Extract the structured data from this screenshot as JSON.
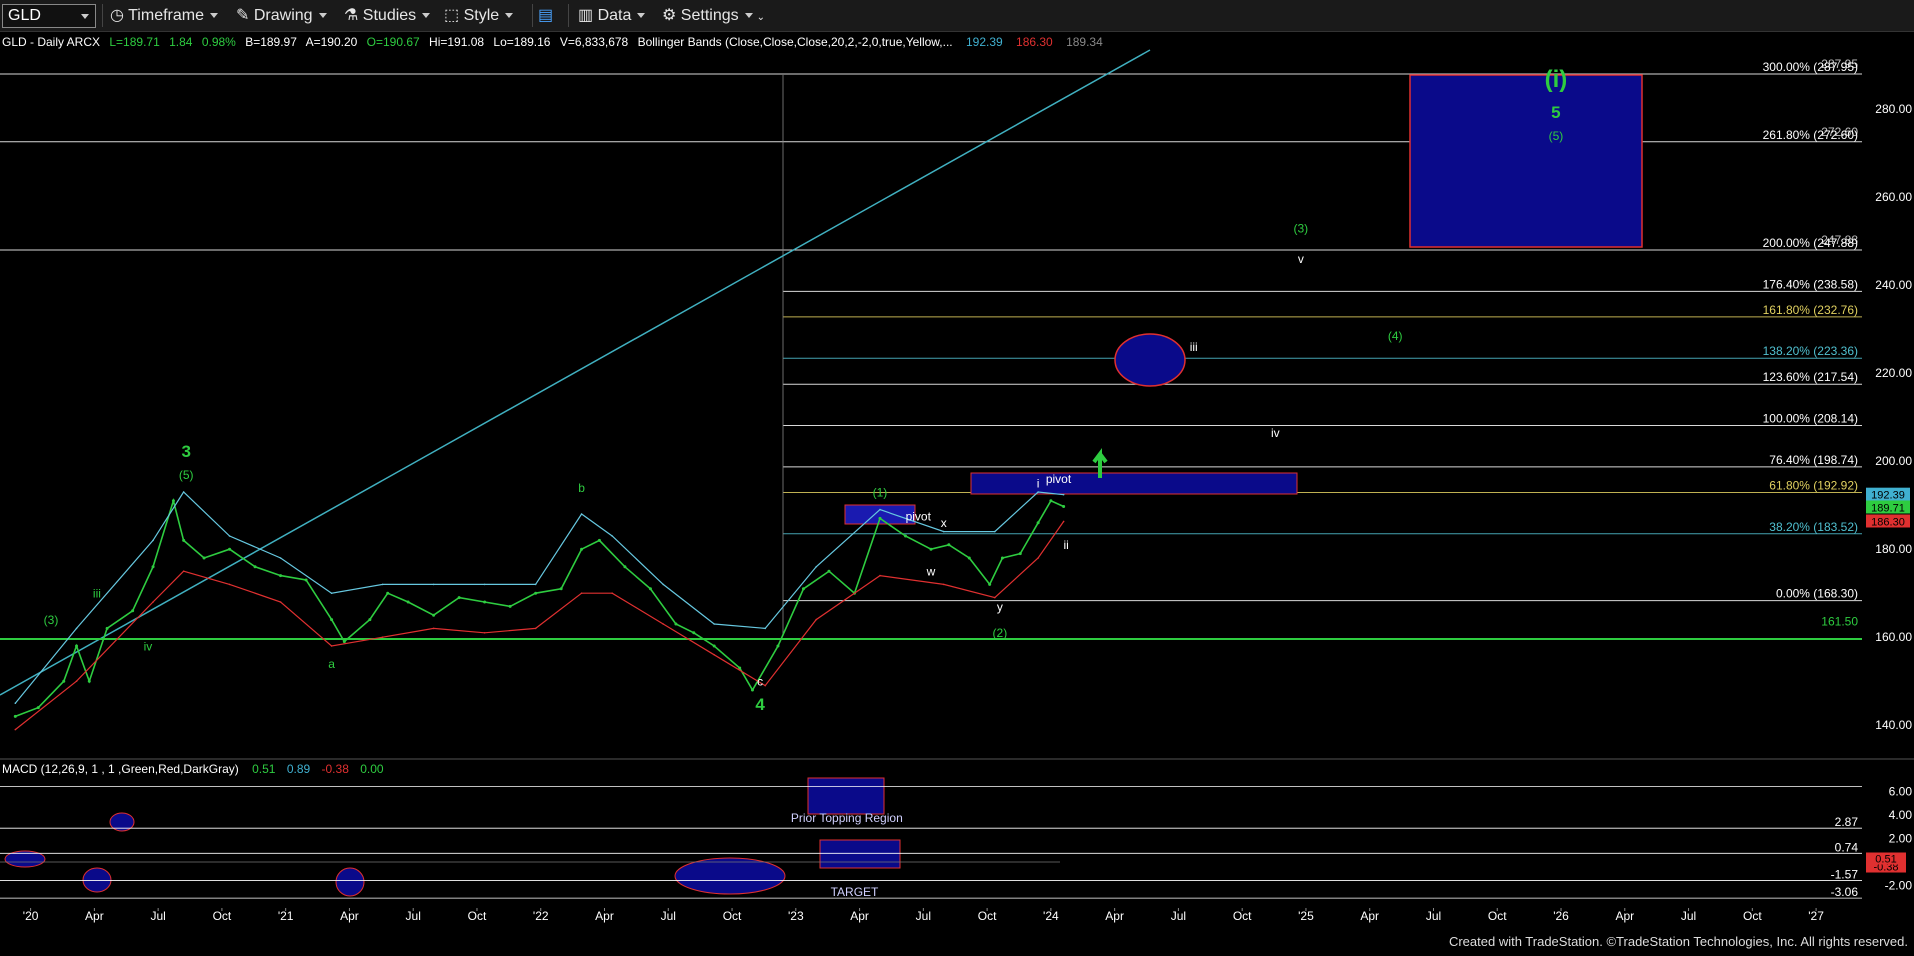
{
  "toolbar": {
    "symbol": "GLD",
    "timeframe_label": "Timeframe",
    "drawing_label": "Drawing",
    "studies_label": "Studies",
    "style_label": "Style",
    "data_label": "Data",
    "settings_label": "Settings"
  },
  "header": {
    "instrument": "GLD - Daily  ARCX",
    "last": "L=189.71",
    "change": "1.84",
    "change_pct": "0.98%",
    "bid": "B=189.97",
    "ask": "A=190.20",
    "open": "O=190.67",
    "high": "Hi=191.08",
    "low": "Lo=189.16",
    "volume": "V=6,833,678",
    "study": "Bollinger Bands (Close,Close,Close,20,2,-2,0,true,Yellow,...",
    "bb_upper": "192.39",
    "bb_lower": "186.30",
    "bb_mid": "189.34"
  },
  "macd_header": {
    "study": "MACD (12,26,9, 1 , 1 ,Green,Red,DarkGray)",
    "macd": "0.51",
    "signal": "0.89",
    "hist": "-0.38",
    "zero": "0.00"
  },
  "footer": {
    "text": "Created with TradeStation. ©TradeStation Technologies, Inc. All rights reserved."
  },
  "chart_data": {
    "type": "line",
    "title": "GLD - Daily",
    "x_ticks": [
      "'20",
      "Apr",
      "Jul",
      "Oct",
      "'21",
      "Apr",
      "Jul",
      "Oct",
      "'22",
      "Apr",
      "Jul",
      "Oct",
      "'23",
      "Apr",
      "Jul",
      "Oct",
      "'24",
      "Apr",
      "Jul",
      "Oct",
      "'25",
      "Apr",
      "Jul",
      "Oct",
      "'26",
      "Apr",
      "Jul",
      "Oct",
      "'27"
    ],
    "y_ticks": [
      "280.00",
      "260.00",
      "240.00",
      "220.00",
      "200.00",
      "180.00",
      "160.00",
      "140.00"
    ],
    "ylim": [
      133,
      293
    ],
    "macd_ticks": [
      "6.00",
      "4.00",
      "2.00",
      "-2.00"
    ],
    "macd_ylim": [
      -3.9,
      7.3
    ],
    "series": [
      {
        "name": "GLD",
        "color": "#2ecc40",
        "x": [
          2019.96,
          2020.05,
          2020.15,
          2020.2,
          2020.25,
          2020.32,
          2020.42,
          2020.5,
          2020.58,
          2020.62,
          2020.7,
          2020.8,
          2020.9,
          2021.0,
          2021.1,
          2021.2,
          2021.25,
          2021.35,
          2021.42,
          2021.5,
          2021.6,
          2021.7,
          2021.8,
          2021.9,
          2022.0,
          2022.1,
          2022.18,
          2022.25,
          2022.35,
          2022.45,
          2022.55,
          2022.62,
          2022.7,
          2022.8,
          2022.85,
          2022.95,
          2023.05,
          2023.15,
          2023.25,
          2023.35,
          2023.45,
          2023.55,
          2023.62,
          2023.7,
          2023.78,
          2023.83,
          2023.9,
          2023.97,
          2024.02,
          2024.07
        ],
        "y": [
          142,
          144,
          150,
          158,
          150,
          162,
          166,
          176,
          191,
          182,
          178,
          180,
          176,
          174,
          173,
          164,
          159,
          164,
          170,
          168,
          165,
          169,
          168,
          167,
          170,
          171,
          180,
          182,
          176,
          171,
          163,
          161,
          158,
          153,
          148,
          158,
          171,
          175,
          170,
          187,
          183,
          180,
          181,
          178,
          172,
          178,
          179,
          186,
          191,
          189.71
        ]
      },
      {
        "name": "upper-band",
        "color": "#66c8e0",
        "x": [
          2019.96,
          2020.2,
          2020.5,
          2020.62,
          2020.8,
          2021.0,
          2021.2,
          2021.4,
          2021.6,
          2021.8,
          2022.0,
          2022.18,
          2022.3,
          2022.5,
          2022.7,
          2022.9,
          2023.1,
          2023.35,
          2023.6,
          2023.8,
          2023.97,
          2024.07
        ],
        "y": [
          145,
          162,
          182,
          193,
          183,
          178,
          170,
          172,
          172,
          172,
          172,
          188,
          183,
          172,
          163,
          162,
          176,
          189,
          184,
          184,
          193,
          192.39
        ]
      },
      {
        "name": "lower-band",
        "color": "#e03030",
        "x": [
          2019.96,
          2020.2,
          2020.5,
          2020.62,
          2020.8,
          2021.0,
          2021.2,
          2021.4,
          2021.6,
          2021.8,
          2022.0,
          2022.18,
          2022.3,
          2022.5,
          2022.7,
          2022.9,
          2023.1,
          2023.35,
          2023.6,
          2023.8,
          2023.97,
          2024.07
        ],
        "y": [
          139,
          150,
          168,
          175,
          172,
          168,
          158,
          160,
          162,
          161,
          162,
          170,
          170,
          163,
          156,
          149,
          164,
          174,
          172,
          169,
          178,
          186.3
        ]
      }
    ],
    "fib_levels": [
      {
        "label": "300.00%",
        "value": "287.95",
        "y": 288,
        "color": "#ffffff"
      },
      {
        "label": "261.80%",
        "value": "272.60",
        "y": 272.6,
        "color": "#ffffff"
      },
      {
        "label": "200.00%",
        "value": "247.88",
        "y": 248,
        "color": "#ffffff"
      },
      {
        "label": "176.40%",
        "value": "238.58",
        "y": 238.6,
        "color": "#ffffff"
      },
      {
        "label": "161.80%",
        "value": "232.76",
        "y": 232.8,
        "color": "#e0d060"
      },
      {
        "label": "138.20%",
        "value": "223.36",
        "y": 223.4,
        "color": "#50c0d0"
      },
      {
        "label": "123.60%",
        "value": "217.54",
        "y": 217.5,
        "color": "#ffffff"
      },
      {
        "label": "100.00%",
        "value": "208.14",
        "y": 208.1,
        "color": "#ffffff"
      },
      {
        "label": "76.40%",
        "value": "198.74",
        "y": 198.7,
        "color": "#ffffff"
      },
      {
        "label": "61.80%",
        "value": "192.92",
        "y": 192.9,
        "color": "#e0d060"
      },
      {
        "label": "38.20%",
        "value": "183.52",
        "y": 183.5,
        "color": "#50c0d0"
      },
      {
        "label": "0.00%",
        "value": "168.30",
        "y": 168.3,
        "color": "#ffffff"
      }
    ],
    "extra_values": [
      "287.95",
      "272.60",
      "247.88"
    ],
    "support_line": {
      "label": "161.50",
      "y": 161.5
    },
    "price_tags": [
      {
        "text": "192.39",
        "y": 192.39,
        "bg": "#40b0d0"
      },
      {
        "text": "189.71",
        "y": 189.71,
        "bg": "#2ecc40"
      },
      {
        "text": "186.30",
        "y": 186.3,
        "bg": "#e03030"
      }
    ],
    "wave_labels": [
      {
        "text": "3",
        "x": 2020.63,
        "y": 201,
        "color": "#2ecc40",
        "size": 17,
        "bold": true
      },
      {
        "text": "(5)",
        "x": 2020.63,
        "y": 196,
        "color": "#2ecc40",
        "size": 12
      },
      {
        "text": "(3)",
        "x": 2020.1,
        "y": 163,
        "color": "#2ecc40",
        "size": 12
      },
      {
        "text": "iii",
        "x": 2020.28,
        "y": 169,
        "color": "#2ecc40",
        "size": 12
      },
      {
        "text": "iv",
        "x": 2020.48,
        "y": 157,
        "color": "#2ecc40",
        "size": 12
      },
      {
        "text": "a",
        "x": 2021.2,
        "y": 153,
        "color": "#2ecc40",
        "size": 12
      },
      {
        "text": "b",
        "x": 2022.18,
        "y": 193,
        "color": "#2ecc40",
        "size": 12
      },
      {
        "text": "c",
        "x": 2022.88,
        "y": 149,
        "color": "#ffffff",
        "size": 12
      },
      {
        "text": "4",
        "x": 2022.88,
        "y": 143.5,
        "color": "#2ecc40",
        "size": 17,
        "bold": true
      },
      {
        "text": "(1)",
        "x": 2023.35,
        "y": 192,
        "color": "#2ecc40",
        "size": 12
      },
      {
        "text": "pivot",
        "x": 2023.5,
        "y": 186.5,
        "color": "#ffffff",
        "size": 12
      },
      {
        "text": "x",
        "x": 2023.6,
        "y": 185,
        "color": "#ffffff",
        "size": 12
      },
      {
        "text": "w",
        "x": 2023.55,
        "y": 174,
        "color": "#ffffff",
        "size": 12
      },
      {
        "text": "y",
        "x": 2023.82,
        "y": 166,
        "color": "#ffffff",
        "size": 12
      },
      {
        "text": "(2)",
        "x": 2023.82,
        "y": 160,
        "color": "#2ecc40",
        "size": 12
      },
      {
        "text": "i",
        "x": 2023.97,
        "y": 194,
        "color": "#ffffff",
        "size": 12
      },
      {
        "text": "pivot",
        "x": 2024.05,
        "y": 195,
        "color": "#ffffff",
        "size": 12
      },
      {
        "text": "ii",
        "x": 2024.08,
        "y": 180,
        "color": "#ffffff",
        "size": 12
      },
      {
        "text": "iii",
        "x": 2024.58,
        "y": 225,
        "color": "#ffffff",
        "size": 12
      },
      {
        "text": "iv",
        "x": 2024.9,
        "y": 205.5,
        "color": "#ffffff",
        "size": 12
      },
      {
        "text": "(3)",
        "x": 2025.0,
        "y": 252,
        "color": "#2ecc40",
        "size": 12
      },
      {
        "text": "v",
        "x": 2025.0,
        "y": 245,
        "color": "#ffffff",
        "size": 12
      },
      {
        "text": "(4)",
        "x": 2025.37,
        "y": 227.5,
        "color": "#2ecc40",
        "size": 12
      },
      {
        "text": "(i)",
        "x": 2026.0,
        "y": 285,
        "color": "#2ecc40",
        "size": 24,
        "bold": true
      },
      {
        "text": "5",
        "x": 2026.0,
        "y": 278,
        "color": "#2ecc40",
        "size": 17,
        "bold": true
      },
      {
        "text": "(5)",
        "x": 2026.0,
        "y": 273,
        "color": "#2ecc40",
        "size": 12
      }
    ],
    "macd_annotations": [
      {
        "text": "Prior Topping Region",
        "x": 2023.22,
        "y": 3.4
      },
      {
        "text": "TARGET",
        "x": 2023.25,
        "y": -2.9
      }
    ],
    "macd_levels": [
      {
        "label": "2.87",
        "y": 2.87
      },
      {
        "label": "0.74",
        "y": 0.74
      },
      {
        "label": "-1.57",
        "y": -1.57
      },
      {
        "label": "-3.06",
        "y": -3.06
      }
    ],
    "macd_value_tags": [
      {
        "text": "-0.38",
        "y": -0.38
      },
      {
        "text": "0.51",
        "y": 0.3
      }
    ]
  }
}
